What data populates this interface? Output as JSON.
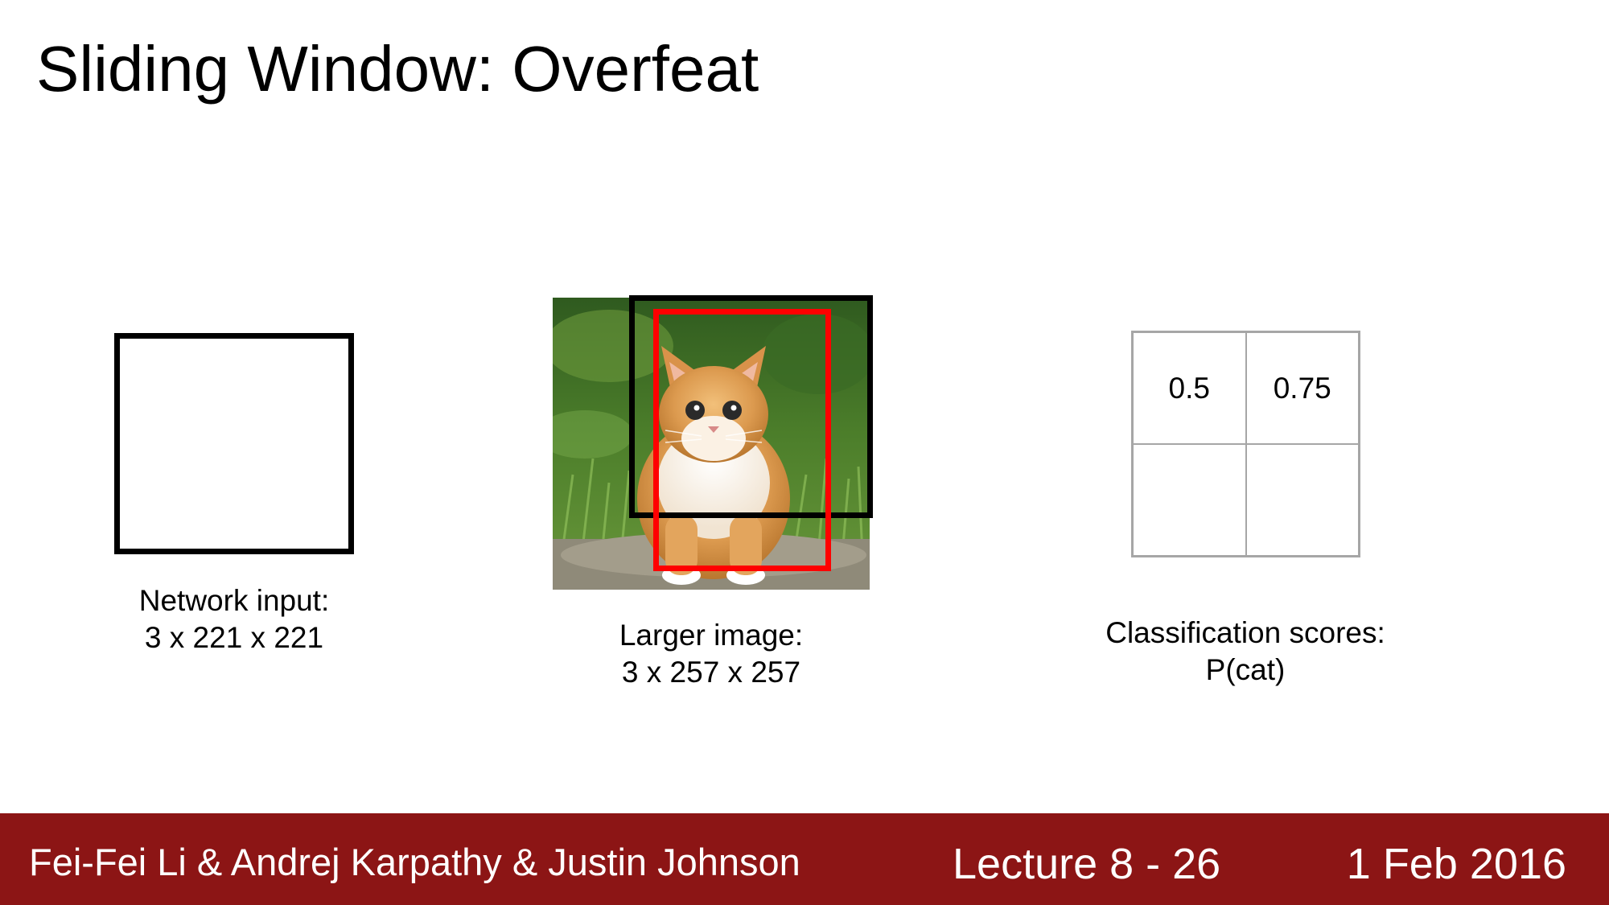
{
  "title": "Sliding Window: Overfeat",
  "network_input": {
    "caption_line1": "Network input:",
    "caption_line2": "3 x 221 x 221"
  },
  "larger_image": {
    "caption_line1": "Larger image:",
    "caption_line2": "3 x 257 x 257",
    "window_colors": {
      "current_window": "#000000",
      "previous_window": "#ff0000"
    }
  },
  "classification": {
    "caption_line1": "Classification scores:",
    "caption_line2": "P(cat)",
    "scores": [
      [
        "0.5",
        "0.75"
      ],
      [
        "",
        ""
      ]
    ]
  },
  "footer": {
    "authors": "Fei-Fei Li & Andrej Karpathy & Justin Johnson",
    "lecture": "Lecture 8 - 26",
    "date": "1 Feb 2016",
    "background_color": "#8c1515"
  }
}
